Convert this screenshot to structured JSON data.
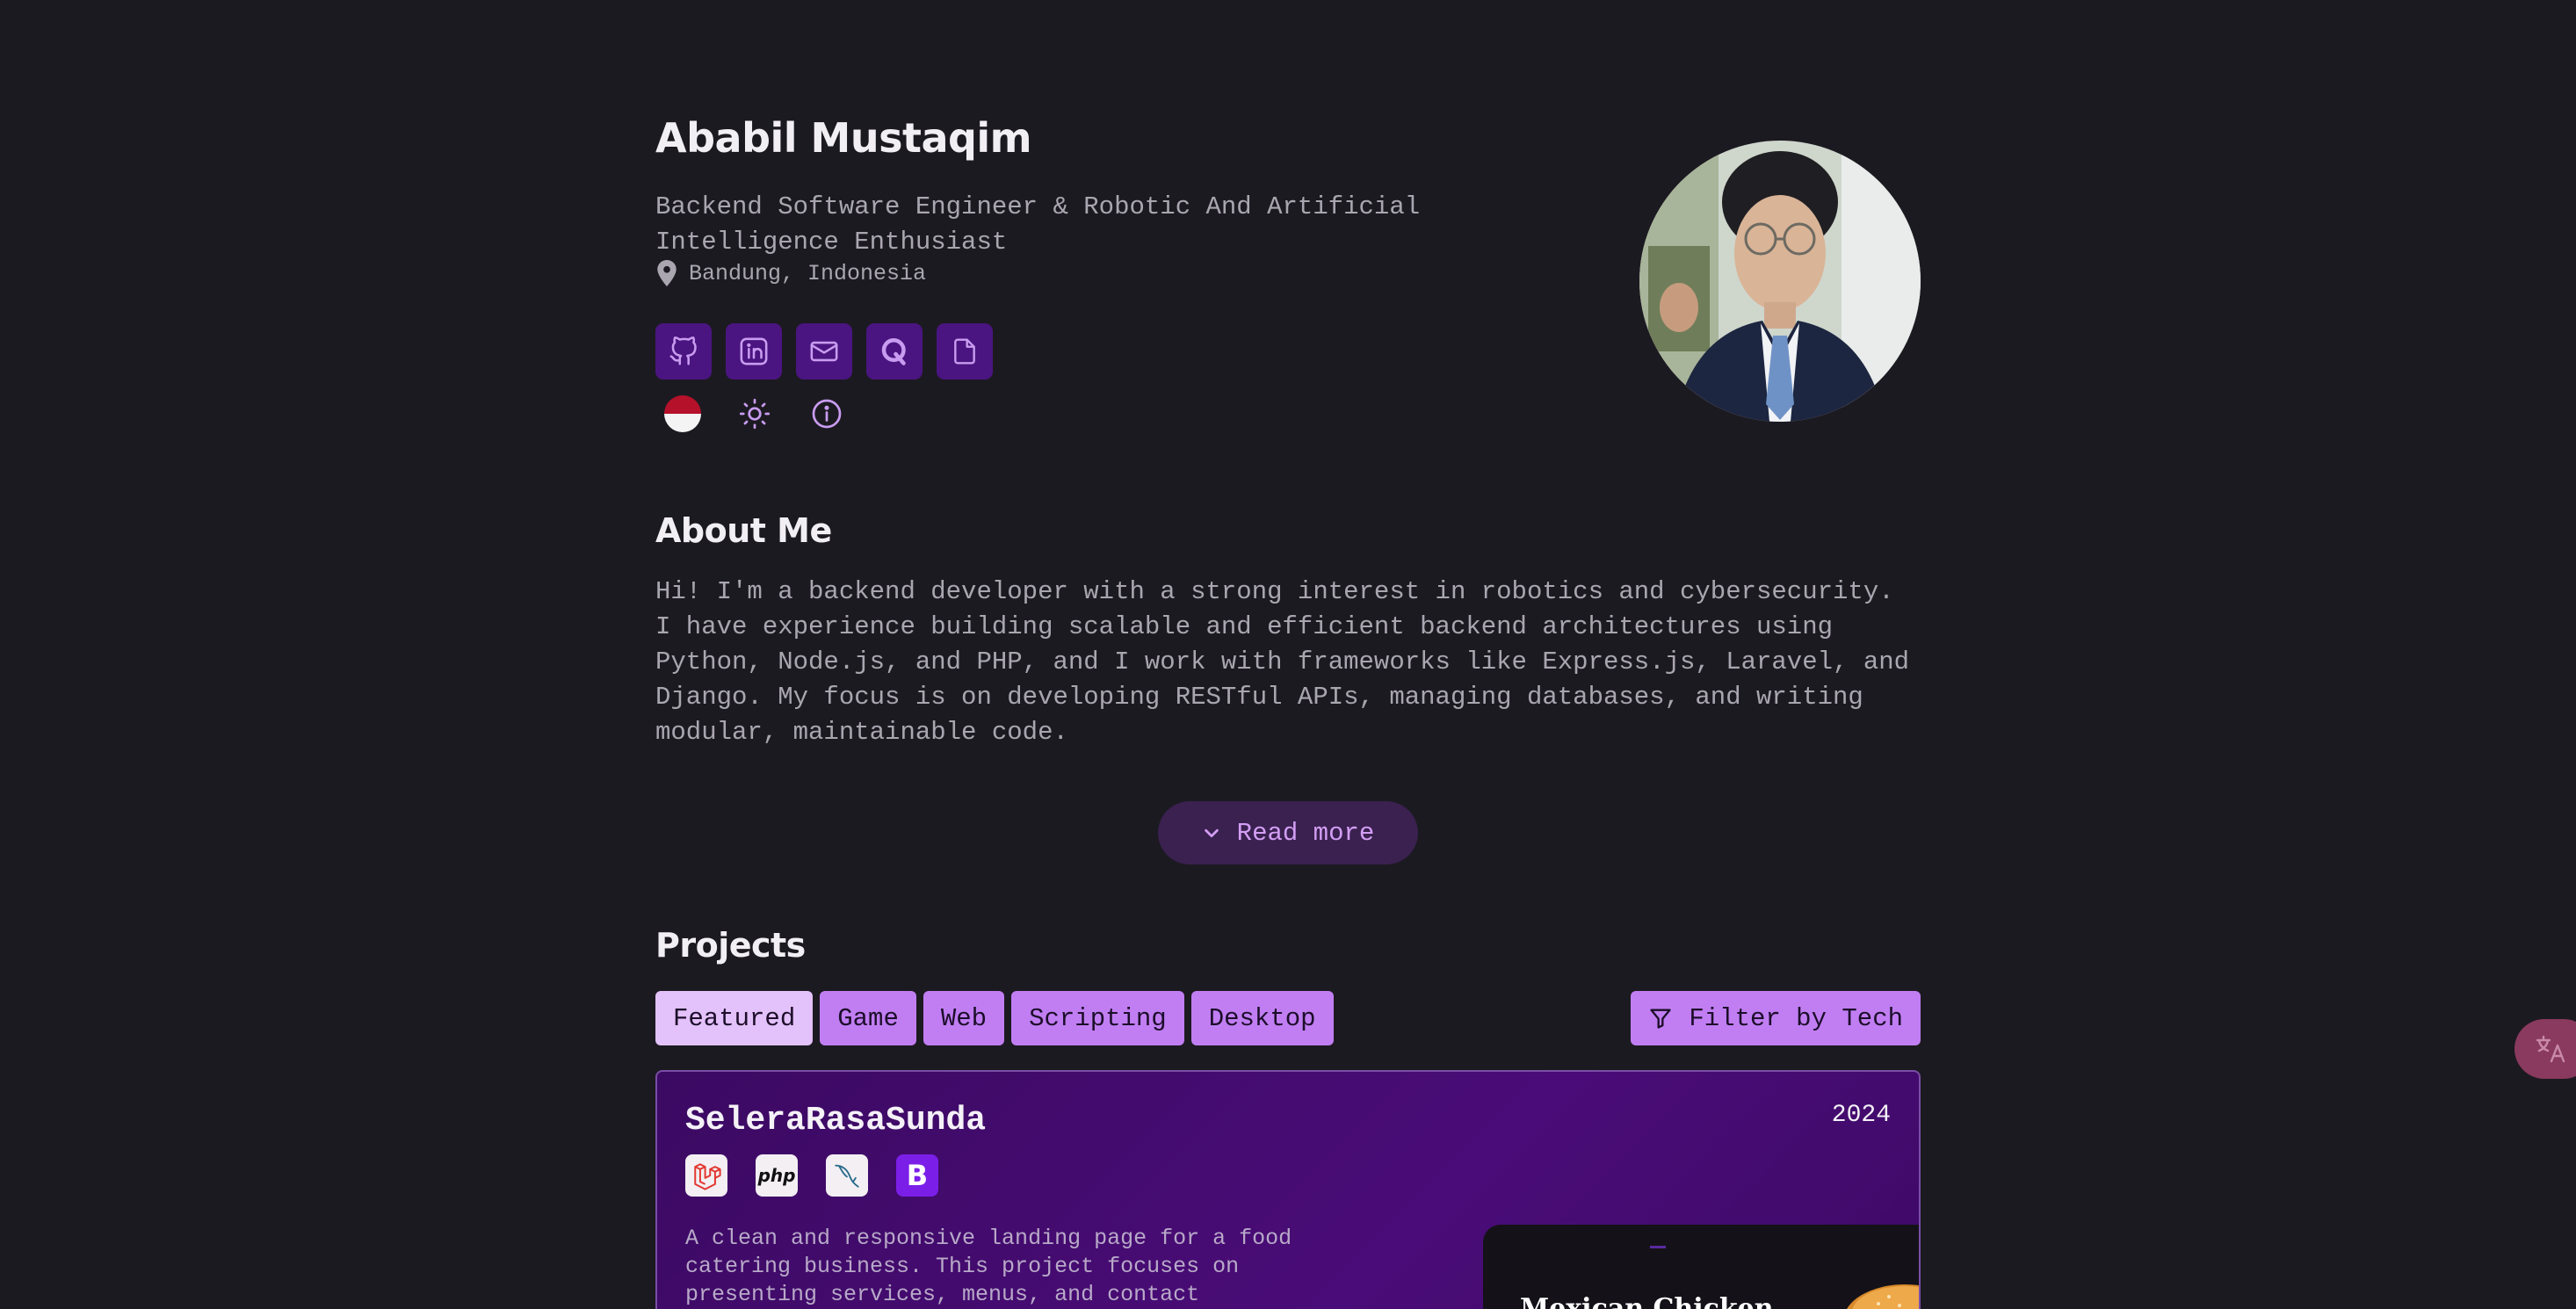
{
  "profile": {
    "name": "Ababil Mustaqim",
    "tagline": "Backend Software Engineer & Robotic And Artificial Intelligence Enthusiast",
    "location": "Bandung, Indonesia"
  },
  "social_links": [
    {
      "icon": "github-icon"
    },
    {
      "icon": "linkedin-icon"
    },
    {
      "icon": "mail-icon"
    },
    {
      "icon": "q-icon"
    },
    {
      "icon": "document-icon"
    }
  ],
  "preferences": [
    {
      "icon": "indonesia-flag-icon"
    },
    {
      "icon": "sun-icon"
    },
    {
      "icon": "info-icon"
    }
  ],
  "about": {
    "title": "About Me",
    "text": "Hi! I'm a backend developer with a strong interest in robotics and cybersecurity. I have experience building scalable and efficient backend architectures using Python, Node.js, and PHP, and I work with frameworks like Express.js, Laravel, and Django. My focus is on developing RESTful APIs, managing databases, and writing modular, maintainable code.",
    "read_more_label": "Read more"
  },
  "projects": {
    "title": "Projects",
    "tabs": [
      {
        "label": "Featured",
        "active": true
      },
      {
        "label": "Game",
        "active": false
      },
      {
        "label": "Web",
        "active": false
      },
      {
        "label": "Scripting",
        "active": false
      },
      {
        "label": "Desktop",
        "active": false
      }
    ],
    "filter_label": "Filter by Tech",
    "cards": [
      {
        "title": "SeleraRasaSunda",
        "year": "2024",
        "tech": [
          "laravel-icon",
          "php-icon",
          "mysql-icon",
          "bootstrap-icon"
        ],
        "bootstrap_letter": "B",
        "php_text": "php",
        "description": "A clean and responsive landing page for a food catering business. This project focuses on presenting services, menus, and contact",
        "preview_heading": "Mexican Chicken"
      }
    ]
  },
  "colors": {
    "background": "#1c1a21",
    "accent": "#c17ef3",
    "accent_active": "#e3c1fa",
    "social_bg": "#4a1580",
    "card_bg": "#4a0c78",
    "heading": "#f1eff4",
    "text": "#a9a6b0"
  }
}
